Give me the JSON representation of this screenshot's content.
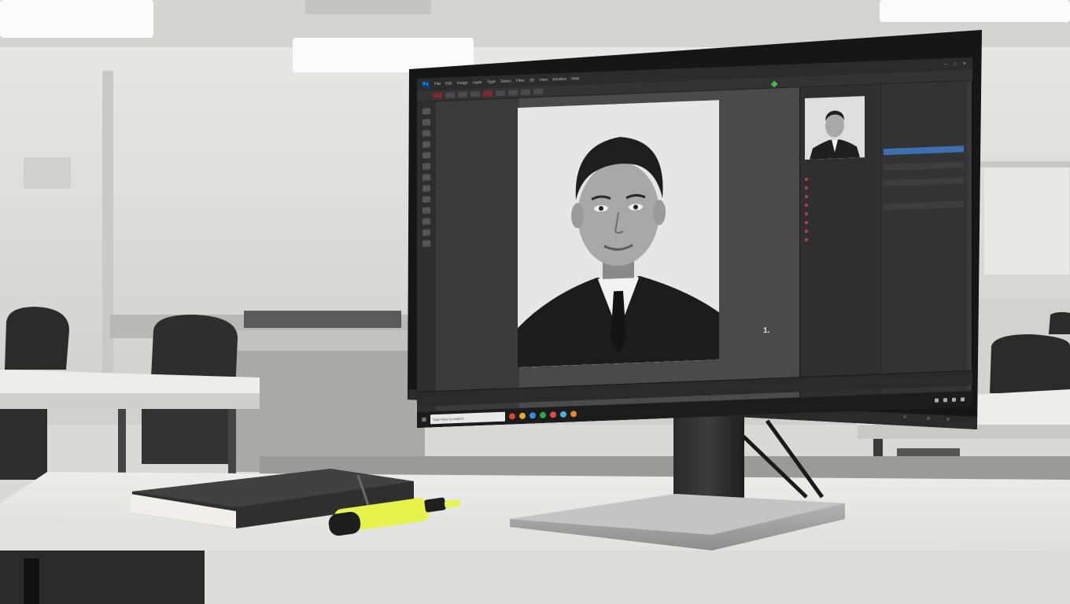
{
  "scene": {
    "description_colors": {
      "wall": "#dcdcda",
      "desk": "#e6e6e6",
      "bezel": "#1b1b1b",
      "highlighter": "#e4f244",
      "notebook": "#3a3a3a"
    }
  },
  "photoshop": {
    "app_badge": "Ps",
    "menus": [
      "File",
      "Edit",
      "Image",
      "Layer",
      "Type",
      "Select",
      "Filter",
      "3D",
      "View",
      "Window",
      "Help"
    ],
    "window_controls": [
      "—",
      "□",
      "✕"
    ],
    "taskbar_search_placeholder": "Type here to search",
    "active_tool": "move-tool",
    "gizmo_label": "1."
  }
}
